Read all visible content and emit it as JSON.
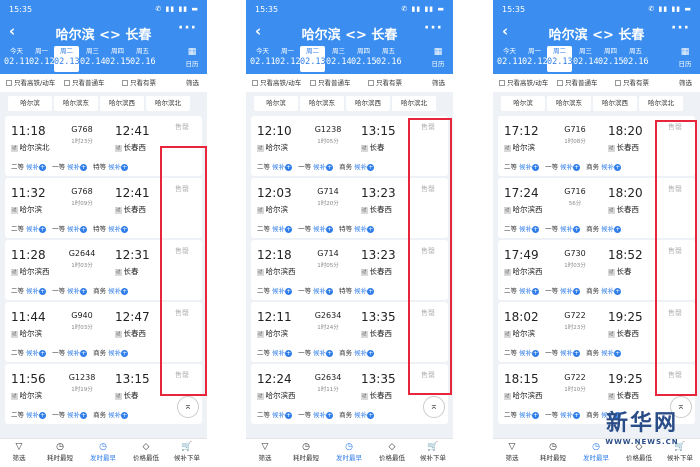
{
  "status_time": "15:35",
  "status_icons": "✆ ▮▮ ▮▮ ▬",
  "title": "哈尔滨 <> 长春",
  "dates": [
    {
      "weekday": "今天",
      "date": "02.11"
    },
    {
      "weekday": "周一",
      "date": "02.12"
    },
    {
      "weekday": "周二",
      "date": "02.13"
    },
    {
      "weekday": "周三",
      "date": "02.14"
    },
    {
      "weekday": "周四",
      "date": "02.15"
    },
    {
      "weekday": "周五",
      "date": "02.16"
    }
  ],
  "selected_date_index": 2,
  "calendar_label": "日历",
  "filters": {
    "high_speed": "只看高铁/动车",
    "normal": "只看普通车",
    "available": "只看有票",
    "filter": "筛选"
  },
  "station_filters": [
    [
      "哈尔滨",
      "哈尔滨东",
      "哈尔滨西",
      "哈尔滨北"
    ],
    [
      "哈尔滨",
      "哈尔滨东",
      "哈尔滨西",
      "哈尔滨北"
    ],
    [
      "哈尔滨",
      "哈尔滨东",
      "哈尔滨西",
      "哈尔滨北"
    ]
  ],
  "sold_out": "售罄",
  "tag_start": "始",
  "tag_pass": "过",
  "tag_end": "终",
  "waitlist": "候补",
  "tabs": [
    "筛选",
    "耗时最短",
    "发时最早",
    "价格最低",
    "候补下单"
  ],
  "active_tab_index": 2,
  "accent_color": "#3b8ef0",
  "highlight_color": "#e8263b",
  "screens": [
    {
      "trains": [
        {
          "dep": "11:18",
          "train": "G768",
          "dur": "1时23分",
          "arr": "12:41",
          "from": "哈尔滨北",
          "to": "长春西",
          "seats": [
            "二等",
            "一等",
            "特等"
          ]
        },
        {
          "dep": "11:32",
          "train": "G768",
          "dur": "1时09分",
          "arr": "12:41",
          "from": "哈尔滨",
          "to": "长春西",
          "seats": [
            "二等",
            "一等",
            "特等"
          ]
        },
        {
          "dep": "11:28",
          "train": "G2644",
          "dur": "1时03分",
          "arr": "12:31",
          "from": "哈尔滨西",
          "to": "长春",
          "seats": [
            "二等",
            "一等",
            "商务"
          ]
        },
        {
          "dep": "11:44",
          "train": "G940",
          "dur": "1时03分",
          "arr": "12:47",
          "from": "哈尔滨",
          "to": "长春西",
          "seats": [
            "二等",
            "一等",
            "商务"
          ]
        },
        {
          "dep": "11:56",
          "train": "G1238",
          "dur": "1时19分",
          "arr": "13:15",
          "from": "哈尔滨",
          "to": "长春",
          "seats": [
            "二等",
            "一等",
            "商务"
          ]
        }
      ]
    },
    {
      "trains": [
        {
          "dep": "12:10",
          "train": "G1238",
          "dur": "1时05分",
          "arr": "13:15",
          "from": "哈尔滨",
          "to": "长春",
          "seats": [
            "二等",
            "一等",
            "商务"
          ]
        },
        {
          "dep": "12:03",
          "train": "G714",
          "dur": "1时20分",
          "arr": "13:23",
          "from": "哈尔滨",
          "to": "长春西",
          "seats": [
            "二等",
            "一等",
            "特等"
          ]
        },
        {
          "dep": "12:18",
          "train": "G714",
          "dur": "1时05分",
          "arr": "13:23",
          "from": "哈尔滨西",
          "to": "长春西",
          "seats": [
            "二等",
            "一等",
            "特等"
          ]
        },
        {
          "dep": "12:11",
          "train": "G2634",
          "dur": "1时24分",
          "arr": "13:35",
          "from": "哈尔滨",
          "to": "长春西",
          "seats": [
            "二等",
            "一等",
            "商务"
          ]
        },
        {
          "dep": "12:24",
          "train": "G2634",
          "dur": "1时11分",
          "arr": "13:35",
          "from": "哈尔滨西",
          "to": "长春西",
          "seats": [
            "二等",
            "一等",
            "商务"
          ]
        }
      ]
    },
    {
      "trains": [
        {
          "dep": "17:12",
          "train": "G716",
          "dur": "1时08分",
          "arr": "18:20",
          "from": "哈尔滨",
          "to": "长春西",
          "seats": [
            "二等",
            "一等",
            "商务"
          ]
        },
        {
          "dep": "17:24",
          "train": "G716",
          "dur": "56分",
          "arr": "18:20",
          "from": "哈尔滨西",
          "to": "长春西",
          "seats": [
            "二等",
            "一等",
            "商务"
          ]
        },
        {
          "dep": "17:49",
          "train": "G730",
          "dur": "1时03分",
          "arr": "18:52",
          "from": "哈尔滨西",
          "to": "长春",
          "seats": [
            "二等",
            "一等",
            "商务"
          ]
        },
        {
          "dep": "18:02",
          "train": "G722",
          "dur": "1时23分",
          "arr": "19:25",
          "from": "哈尔滨",
          "to": "长春西",
          "seats": [
            "二等",
            "一等",
            "商务"
          ]
        },
        {
          "dep": "18:15",
          "train": "G722",
          "dur": "1时10分",
          "arr": "19:25",
          "from": "哈尔滨西",
          "to": "长春西",
          "seats": [
            "二等",
            "一等",
            "商务"
          ]
        }
      ]
    }
  ],
  "watermark": {
    "cn": "新华网",
    "en": "WWW.NEWS.CN"
  }
}
